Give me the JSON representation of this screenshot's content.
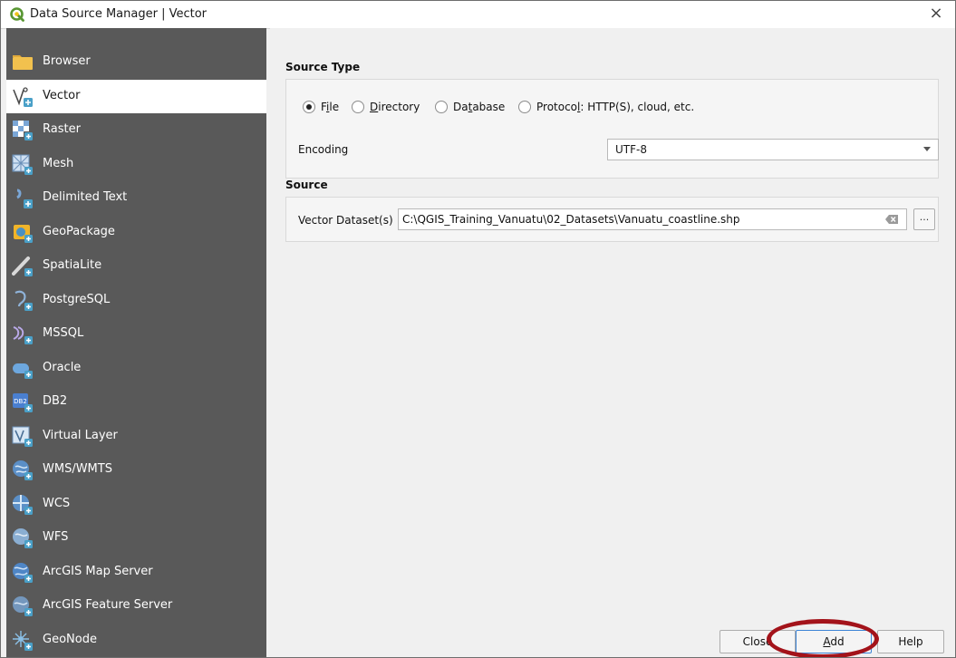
{
  "window": {
    "title": "Data Source Manager | Vector",
    "close_glyph": "×"
  },
  "sidebar": {
    "items": [
      {
        "label": "Browser",
        "icon": "folder-icon"
      },
      {
        "label": "Vector",
        "icon": "vector-icon",
        "selected": true
      },
      {
        "label": "Raster",
        "icon": "raster-icon"
      },
      {
        "label": "Mesh",
        "icon": "mesh-icon"
      },
      {
        "label": "Delimited Text",
        "icon": "delimited-text-icon"
      },
      {
        "label": "GeoPackage",
        "icon": "geopackage-icon"
      },
      {
        "label": "SpatiaLite",
        "icon": "spatialite-icon"
      },
      {
        "label": "PostgreSQL",
        "icon": "postgresql-icon"
      },
      {
        "label": "MSSQL",
        "icon": "mssql-icon"
      },
      {
        "label": "Oracle",
        "icon": "oracle-icon"
      },
      {
        "label": "DB2",
        "icon": "db2-icon"
      },
      {
        "label": "Virtual Layer",
        "icon": "virtual-layer-icon"
      },
      {
        "label": "WMS/WMTS",
        "icon": "wms-icon"
      },
      {
        "label": "WCS",
        "icon": "wcs-icon"
      },
      {
        "label": "WFS",
        "icon": "wfs-icon"
      },
      {
        "label": "ArcGIS Map Server",
        "icon": "arcgis-map-icon"
      },
      {
        "label": "ArcGIS Feature Server",
        "icon": "arcgis-feature-icon"
      },
      {
        "label": "GeoNode",
        "icon": "geonode-icon"
      }
    ]
  },
  "source_type": {
    "title": "Source Type",
    "options": [
      {
        "pre": "F",
        "u": "i",
        "post": "le",
        "checked": true
      },
      {
        "pre": "",
        "u": "D",
        "post": "irectory",
        "checked": false
      },
      {
        "pre": "Da",
        "u": "t",
        "post": "abase",
        "checked": false
      },
      {
        "pre": "Protoco",
        "u": "l",
        "post": ": HTTP(S), cloud, etc.",
        "checked": false
      }
    ],
    "encoding_label": "Encoding",
    "encoding_value": "UTF-8"
  },
  "source": {
    "title": "Source",
    "dataset_label": "Vector Dataset(s)",
    "dataset_value": "C:\\QGIS_Training_Vanuatu\\02_Datasets\\Vanuatu_coastline.shp",
    "browse_label": "..."
  },
  "buttons": {
    "close": "Close",
    "add_pre": "",
    "add_u": "A",
    "add_post": "dd",
    "help": "Help"
  },
  "colors": {
    "sidebar_bg": "#595959",
    "highlight_ring": "#a3131a",
    "qgis_green": "#6aa84f"
  }
}
